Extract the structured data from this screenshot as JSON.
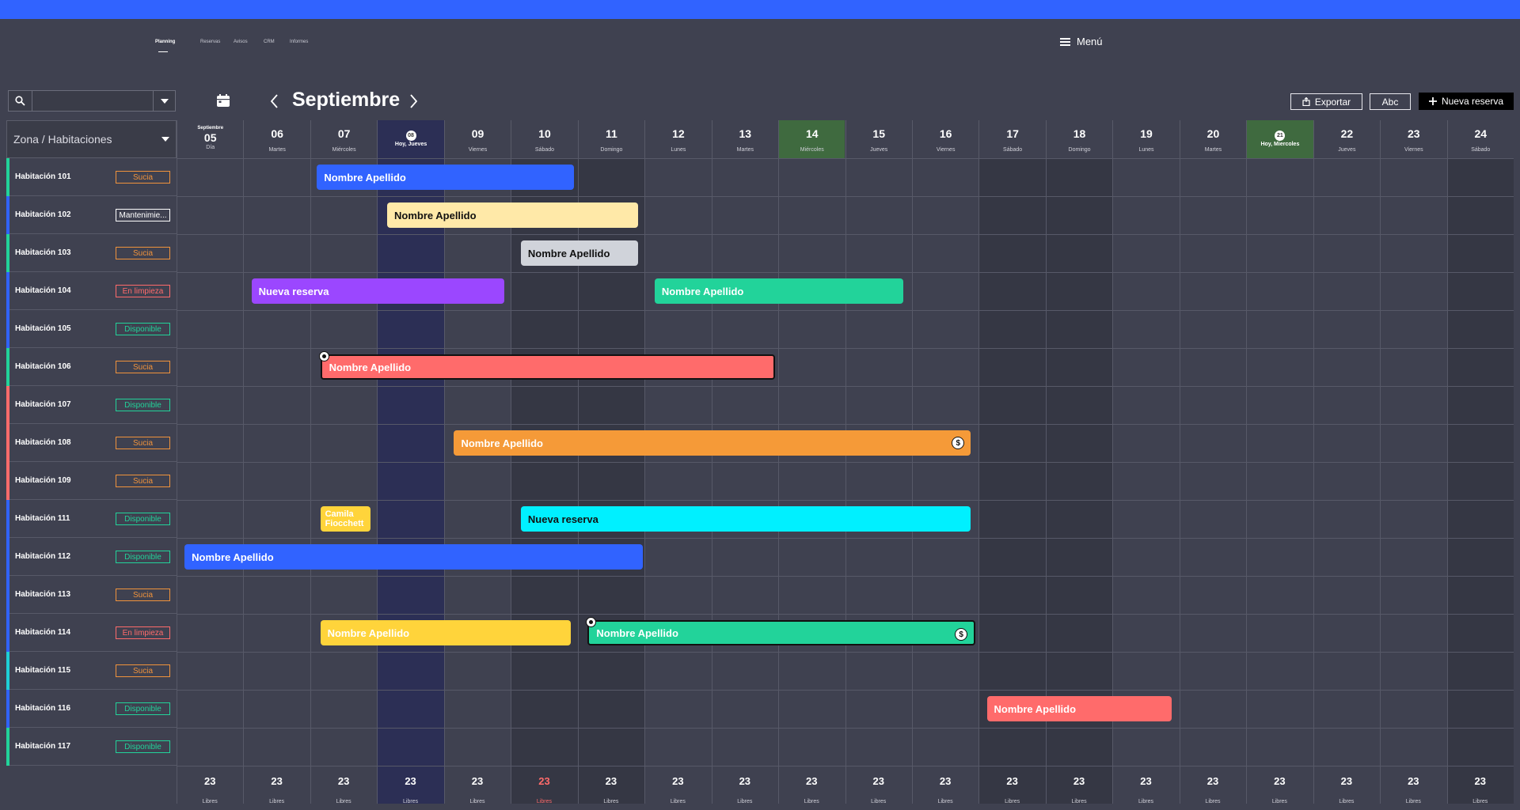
{
  "nav": {
    "items": [
      {
        "label": "Planning",
        "active": true
      },
      {
        "label": "Reservas",
        "active": false
      },
      {
        "label": "Avisos",
        "active": false
      },
      {
        "label": "CRM",
        "active": false
      },
      {
        "label": "Informes",
        "active": false
      }
    ],
    "menu_label": "Menú"
  },
  "toolbar": {
    "search_placeholder": "",
    "month": "Septiembre",
    "export_label": "Exportar",
    "abc_label": "Abc",
    "new_label": "Nueva reserva",
    "icons": [
      "search-icon",
      "chevron-down-icon",
      "calendar-icon",
      "chevron-left-icon",
      "chevron-right-icon",
      "export-icon",
      "plus-icon",
      "hamburger-icon"
    ]
  },
  "grid": {
    "zone_label": "Zona / Habitaciones",
    "first_day": {
      "month": "Septiembre",
      "num": "05",
      "label": "Día"
    },
    "days": [
      {
        "num": "06",
        "wd": "Martes",
        "type": "normal"
      },
      {
        "num": "07",
        "wd": "Miércoles",
        "type": "normal"
      },
      {
        "num": "08",
        "wd": "Hoy, Jueves",
        "type": "today"
      },
      {
        "num": "09",
        "wd": "Viernes",
        "type": "normal"
      },
      {
        "num": "10",
        "wd": "Sábado",
        "type": "dark"
      },
      {
        "num": "11",
        "wd": "Domingo",
        "type": "dark"
      },
      {
        "num": "12",
        "wd": "Lunes",
        "type": "normal"
      },
      {
        "num": "13",
        "wd": "Martes",
        "type": "normal"
      },
      {
        "num": "14",
        "wd": "Miércoles",
        "type": "green"
      },
      {
        "num": "15",
        "wd": "Jueves",
        "type": "normal"
      },
      {
        "num": "16",
        "wd": "Viernes",
        "type": "normal"
      },
      {
        "num": "17",
        "wd": "Sábado",
        "type": "dark"
      },
      {
        "num": "18",
        "wd": "Domingo",
        "type": "dark"
      },
      {
        "num": "19",
        "wd": "Lunes",
        "type": "normal"
      },
      {
        "num": "20",
        "wd": "Martes",
        "type": "normal"
      },
      {
        "num": "21",
        "wd": "Hoy, Miercoles",
        "type": "today-green"
      },
      {
        "num": "22",
        "wd": "Jueves",
        "type": "normal"
      },
      {
        "num": "23",
        "wd": "Viernes",
        "type": "normal"
      },
      {
        "num": "24",
        "wd": "Sábado",
        "type": "dark"
      }
    ],
    "rooms": [
      {
        "name": "Habitación 101",
        "status": "Sucia",
        "status_color": "#f0933c",
        "accent": "#22d39a"
      },
      {
        "name": "Habitación 102",
        "status": "Mantenimie...",
        "status_color": "#ffffff",
        "accent": "#3163ff"
      },
      {
        "name": "Habitación 103",
        "status": "Sucia",
        "status_color": "#f0933c",
        "accent": "#22d39a"
      },
      {
        "name": "Habitación 104",
        "status": "En limpieza",
        "status_color": "#ff6b6b",
        "accent": "#3163ff"
      },
      {
        "name": "Habitación 105",
        "status": "Disponible",
        "status_color": "#22d39a",
        "accent": "#3163ff"
      },
      {
        "name": "Habitación 106",
        "status": "Sucia",
        "status_color": "#f0933c",
        "accent": "#22d39a"
      },
      {
        "name": "Habitación 107",
        "status": "Disponible",
        "status_color": "#22d39a",
        "accent": "#ff6b6b"
      },
      {
        "name": "Habitación 108",
        "status": "Sucia",
        "status_color": "#f0933c",
        "accent": "#ff6b6b"
      },
      {
        "name": "Habitación 109",
        "status": "Sucia",
        "status_color": "#f0933c",
        "accent": "#ff6b6b"
      },
      {
        "name": "Habitación 111",
        "status": "Disponible",
        "status_color": "#22d39a",
        "accent": "#3163ff"
      },
      {
        "name": "Habitación 112",
        "status": "Disponible",
        "status_color": "#22d39a",
        "accent": "#3163ff"
      },
      {
        "name": "Habitación 113",
        "status": "Sucia",
        "status_color": "#f0933c",
        "accent": "#3163ff"
      },
      {
        "name": "Habitación 114",
        "status": "En limpieza",
        "status_color": "#ff6b6b",
        "accent": "#3163ff"
      },
      {
        "name": "Habitación 115",
        "status": "Sucia",
        "status_color": "#f0933c",
        "accent": "#1ecfd6"
      },
      {
        "name": "Habitación 116",
        "status": "Disponible",
        "status_color": "#22d39a",
        "accent": "#3163ff"
      },
      {
        "name": "Habitación 117",
        "status": "Disponible",
        "status_color": "#22d39a",
        "accent": "#22d39a"
      }
    ],
    "bookings": [
      {
        "room": 0,
        "start": 2.1,
        "end": 5.95,
        "label": "Nombre Apellido",
        "color": "#3163ff",
        "text": "#ffffff"
      },
      {
        "room": 1,
        "start": 3.15,
        "end": 6.9,
        "label": "Nombre Apellido",
        "color": "#ffe9a8",
        "text": "#111111"
      },
      {
        "room": 2,
        "start": 5.15,
        "end": 6.9,
        "label": "Nombre Apellido",
        "color": "#d0d3da",
        "text": "#111111"
      },
      {
        "room": 3,
        "start": 1.12,
        "end": 4.9,
        "label": "Nueva reserva",
        "color": "#9b47ff",
        "text": "#ffffff"
      },
      {
        "room": 3,
        "start": 7.15,
        "end": 10.87,
        "label": "Nombre Apellido",
        "color": "#22d39a",
        "text": "#ffffff"
      },
      {
        "room": 5,
        "start": 2.15,
        "end": 8.95,
        "label": "Nombre Apellido",
        "color": "#ff6b6b",
        "text": "#ffffff",
        "outlined": true,
        "pin": true
      },
      {
        "room": 7,
        "start": 4.15,
        "end": 11.88,
        "label": "Nombre Apellido",
        "color": "#f59a38",
        "text": "#ffffff",
        "dollar": "$"
      },
      {
        "room": 9,
        "start": 2.15,
        "end": 2.9,
        "label": "Camila Fiocchett",
        "color": "#ffd43b",
        "text": "#ffffff",
        "small": true
      },
      {
        "room": 9,
        "start": 5.15,
        "end": 11.88,
        "label": "Nueva reserva",
        "color": "#00f0ff",
        "text": "#111111"
      },
      {
        "room": 10,
        "start": 0.12,
        "end": 6.97,
        "label": "Nombre Apellido",
        "color": "#3163ff",
        "text": "#ffffff"
      },
      {
        "room": 12,
        "start": 2.15,
        "end": 5.9,
        "label": "Nombre Apellido",
        "color": "#ffd43b",
        "text": "#ffffff"
      },
      {
        "room": 12,
        "start": 6.15,
        "end": 11.95,
        "label": "Nombre Apellido",
        "color": "#22d39a",
        "text": "#ffffff",
        "outlined": true,
        "pin": true,
        "dollar": "$"
      },
      {
        "room": 14,
        "start": 12.12,
        "end": 14.88,
        "label": "Nombre Apellido",
        "color": "#ff6b6b",
        "text": "#ffffff"
      }
    ],
    "footer": [
      {
        "n": "23",
        "l": "Libres",
        "highlight": false
      },
      {
        "n": "23",
        "l": "Libres",
        "highlight": false
      },
      {
        "n": "23",
        "l": "Libres",
        "highlight": false
      },
      {
        "n": "23",
        "l": "Libres",
        "highlight": false
      },
      {
        "n": "23",
        "l": "Libres",
        "highlight": false
      },
      {
        "n": "23",
        "l": "Libres",
        "highlight": true
      },
      {
        "n": "23",
        "l": "Libres",
        "highlight": false
      },
      {
        "n": "23",
        "l": "Libres",
        "highlight": false
      },
      {
        "n": "23",
        "l": "Libres",
        "highlight": false
      },
      {
        "n": "23",
        "l": "Libres",
        "highlight": false
      },
      {
        "n": "23",
        "l": "Libres",
        "highlight": false
      },
      {
        "n": "23",
        "l": "Libres",
        "highlight": false
      },
      {
        "n": "23",
        "l": "Libres",
        "highlight": false
      },
      {
        "n": "23",
        "l": "Libres",
        "highlight": false
      },
      {
        "n": "23",
        "l": "Libres",
        "highlight": false
      },
      {
        "n": "23",
        "l": "Libres",
        "highlight": false
      },
      {
        "n": "23",
        "l": "Libres",
        "highlight": false
      },
      {
        "n": "23",
        "l": "Libres",
        "highlight": false
      },
      {
        "n": "23",
        "l": "Libres",
        "highlight": false
      },
      {
        "n": "23",
        "l": "Libres",
        "highlight": false
      }
    ]
  }
}
